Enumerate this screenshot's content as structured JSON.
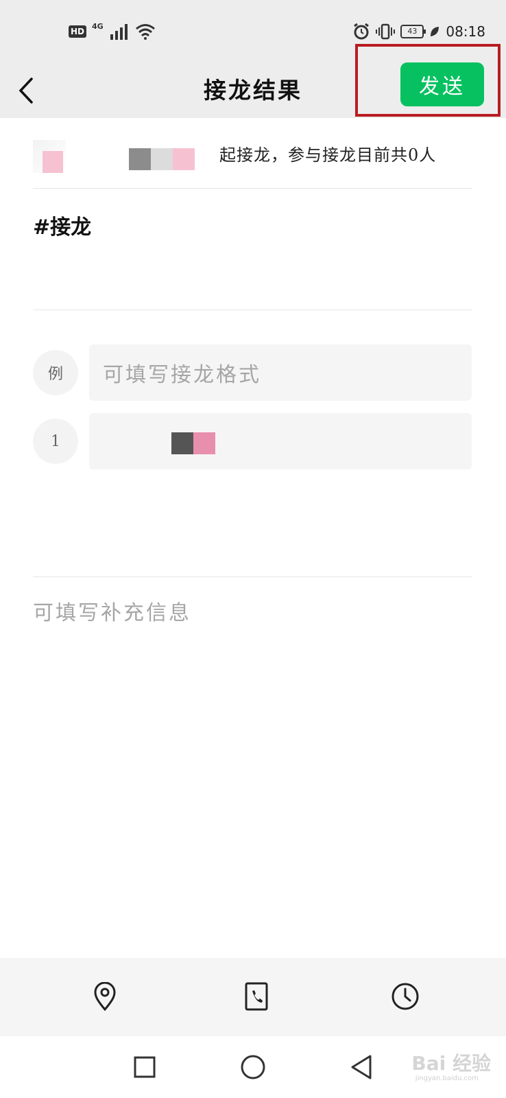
{
  "status_bar": {
    "hd": "HD",
    "network": "4G",
    "battery": "43",
    "time": "08:18"
  },
  "header": {
    "title": "接龙结果",
    "send_label": "发送"
  },
  "starter": {
    "text": "起接龙，参与接龙目前共0人"
  },
  "topic": "#接龙",
  "entries": [
    {
      "label": "例",
      "placeholder": "可填写接龙格式"
    },
    {
      "label": "1",
      "value": ""
    }
  ],
  "extra_info_placeholder": "可填写补充信息",
  "toolbar": {
    "items": [
      "location-icon",
      "phone-icon",
      "clock-icon"
    ]
  },
  "system_nav": [
    "recents-square-icon",
    "home-circle-icon",
    "back-triangle-icon"
  ],
  "watermark": {
    "text": "Bai 经验",
    "sub": "jingyan.baidu.com"
  },
  "colors": {
    "accent": "#07c160",
    "highlight": "#b81c22",
    "header_bg": "#ededed"
  }
}
